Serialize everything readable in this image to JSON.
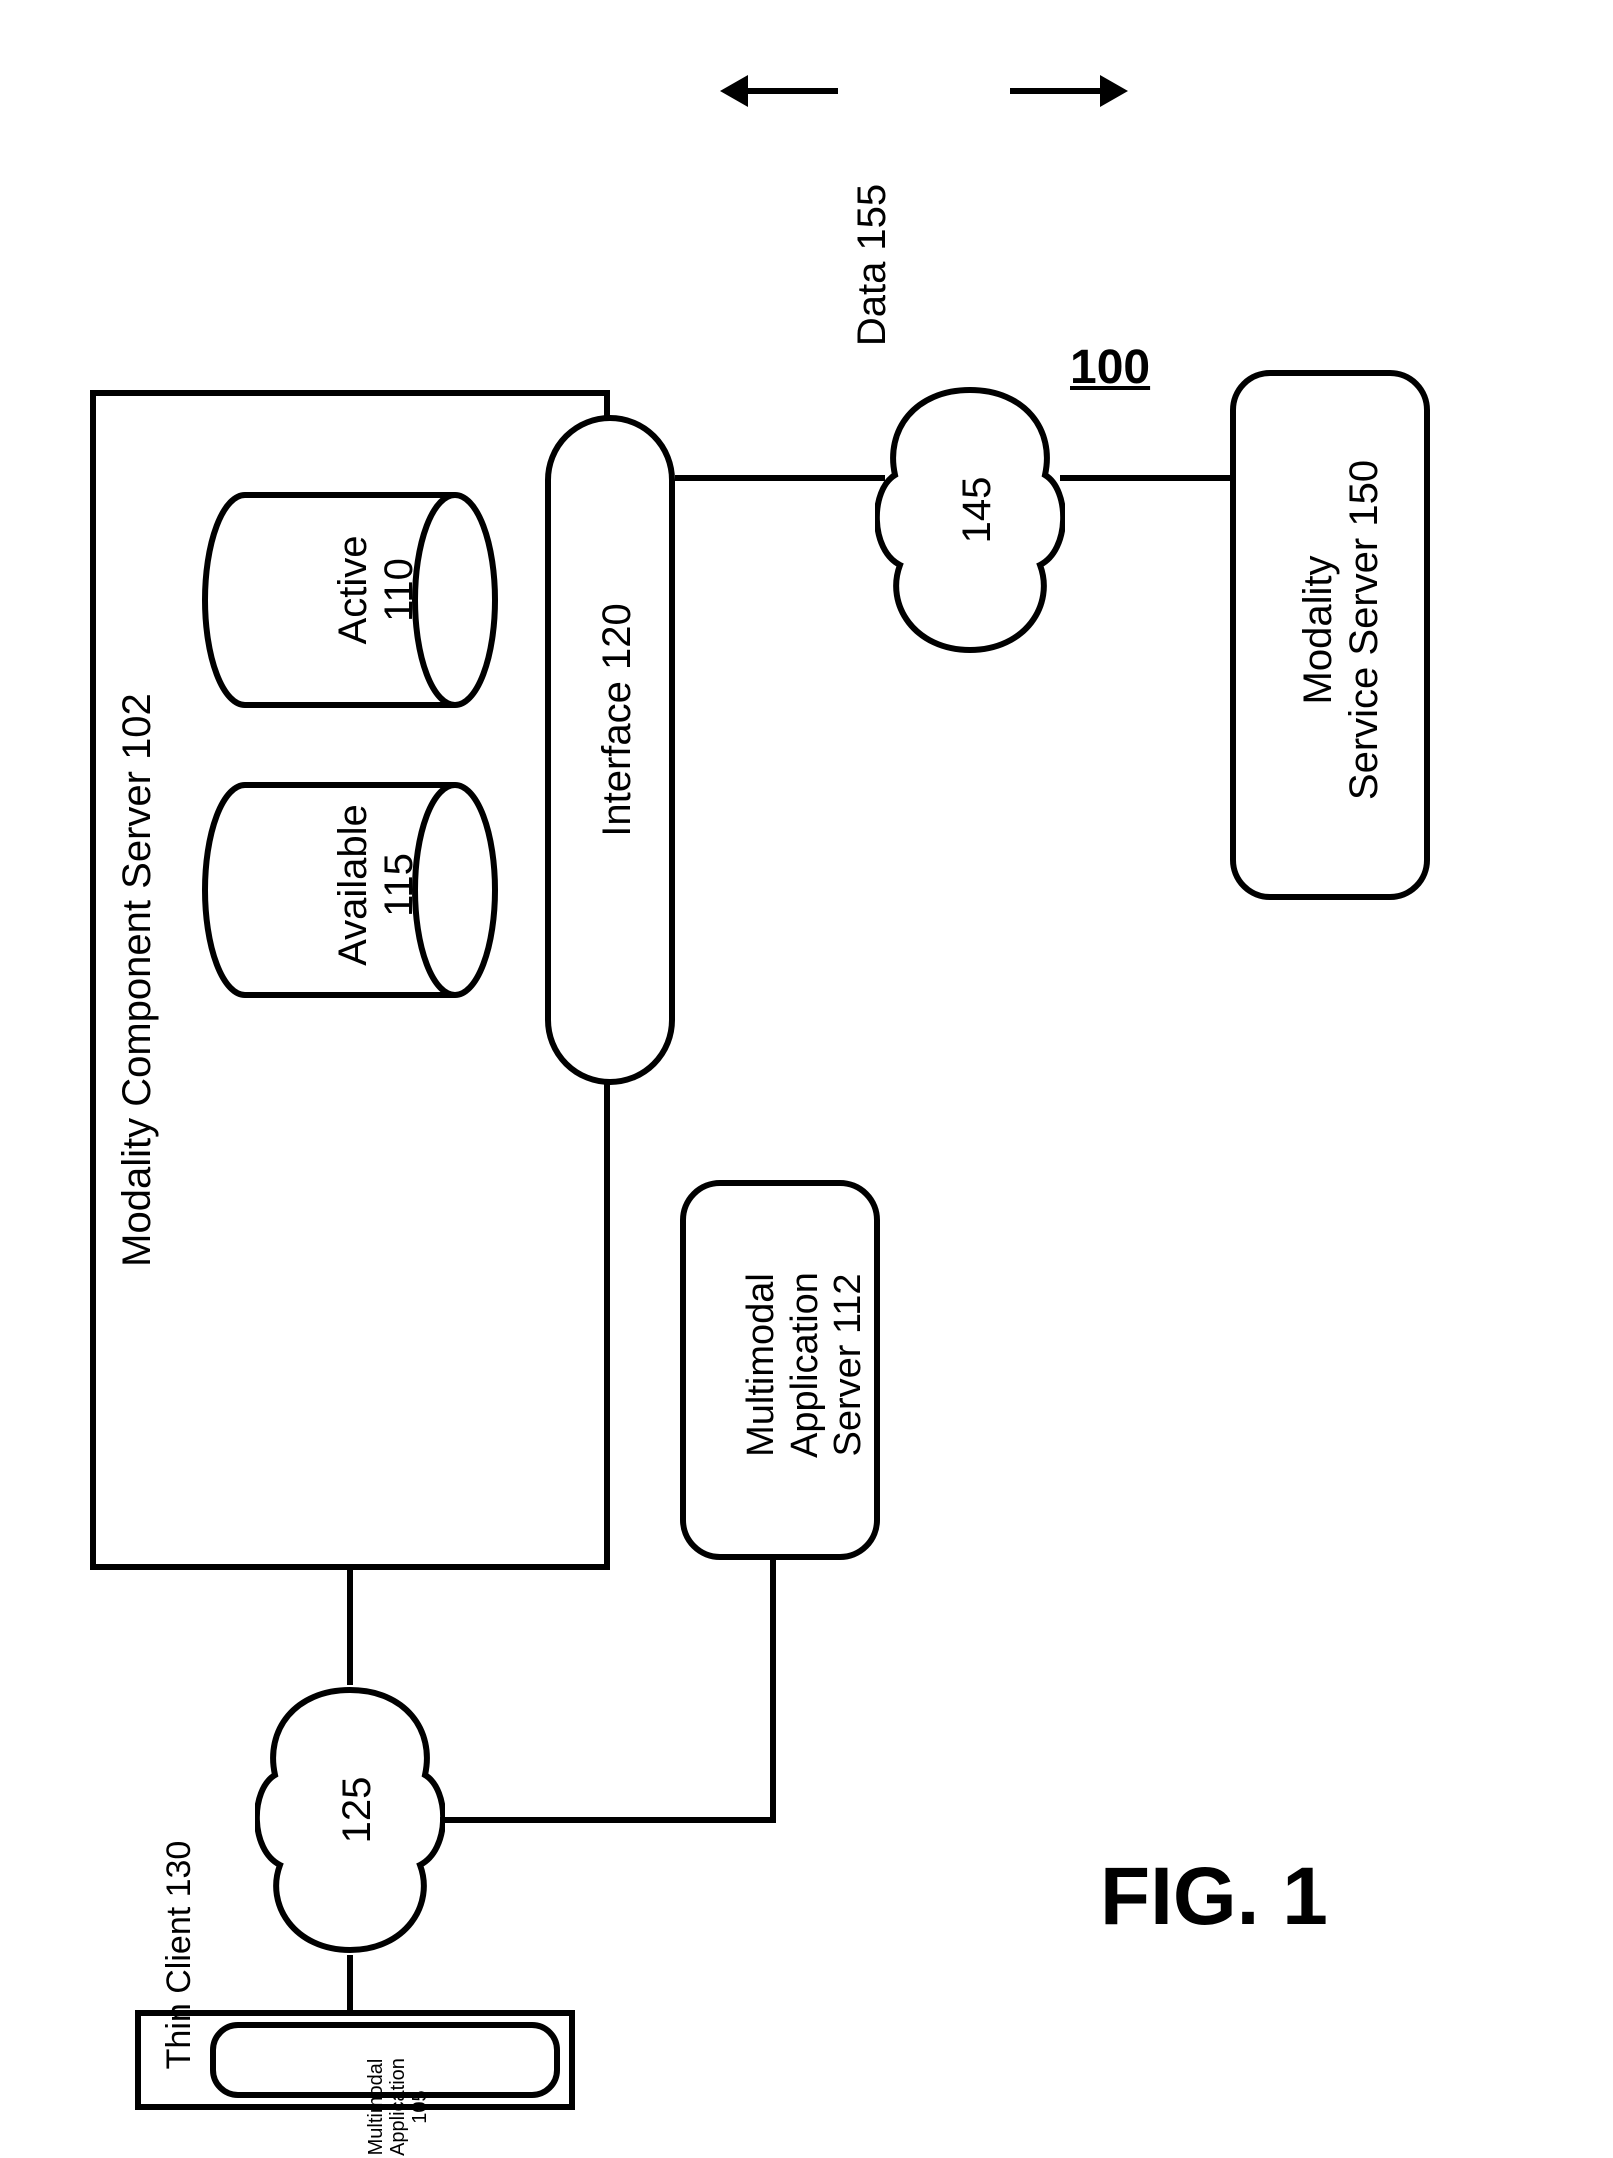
{
  "figure_number": "100",
  "figure_label": "FIG. 1",
  "modality_component_server": {
    "label": "Modality Component Server 102",
    "active_db": "Active\n110",
    "available_db": "Available\n115",
    "interface": "Interface 120"
  },
  "cloud_125": "125",
  "cloud_145": "145",
  "data_label": "Data 155",
  "thin_client": {
    "box_label": "Thin Client 130",
    "app_label": "Multimodal\nApplication\n105"
  },
  "multimodal_app_server": "Multimodal\nApplication\nServer 112",
  "modality_service_server": "Modality\nService Server 150"
}
